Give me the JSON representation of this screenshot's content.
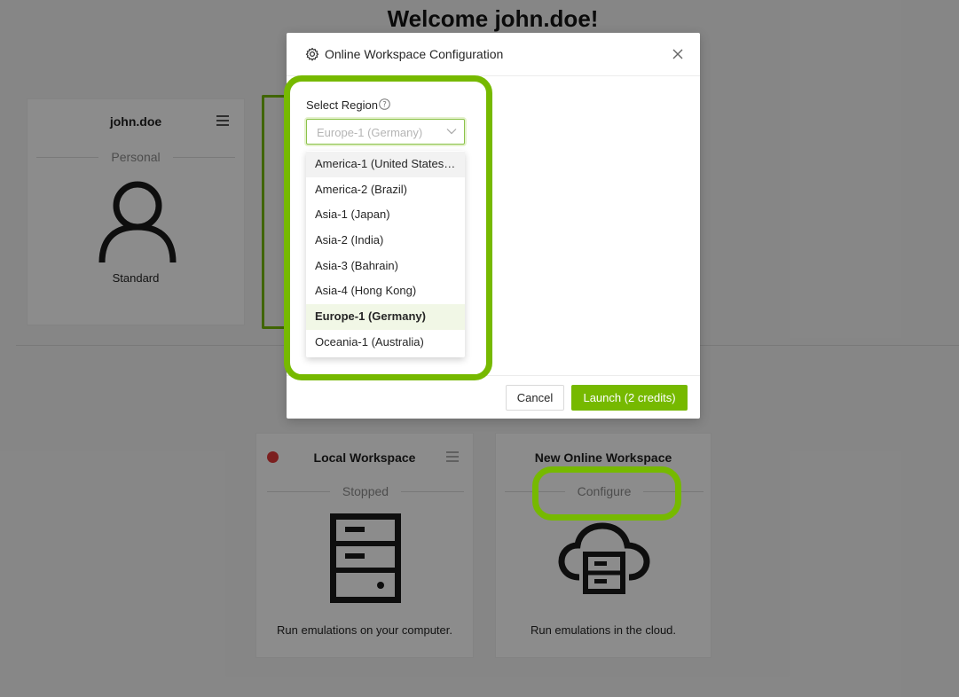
{
  "page": {
    "welcome_title": "Welcome john.doe!"
  },
  "user_card": {
    "name": "john.doe",
    "divider": "Personal",
    "role": "Standard"
  },
  "local_workspace": {
    "title": "Local Workspace",
    "status": "Stopped",
    "status_color": "#e03a3a",
    "caption": "Run emulations on your computer."
  },
  "online_workspace": {
    "title": "New Online Workspace",
    "divider": "Configure",
    "caption": "Run emulations in the cloud."
  },
  "modal": {
    "title": "Online Workspace Configuration",
    "region_label": "Select Region",
    "selected_value": "Europe-1 (Germany)",
    "options": [
      "America-1 (United States ...",
      "America-2 (Brazil)",
      "Asia-1 (Japan)",
      "Asia-2 (India)",
      "Asia-3 (Bahrain)",
      "Asia-4 (Hong Kong)",
      "Europe-1 (Germany)",
      "Oceania-1 (Australia)"
    ],
    "cancel_label": "Cancel",
    "launch_label": "Launch (2 credits)"
  },
  "colors": {
    "accent": "#76b900",
    "overlay": "rgba(0,0,0,0.45)"
  },
  "icons": {
    "gear": "gear-icon",
    "close": "close-icon",
    "help": "help-icon",
    "chevron": "chevron-down-icon",
    "menu": "menu-icon",
    "user": "user-icon",
    "server": "server-icon",
    "cloud": "cloud-server-icon"
  }
}
